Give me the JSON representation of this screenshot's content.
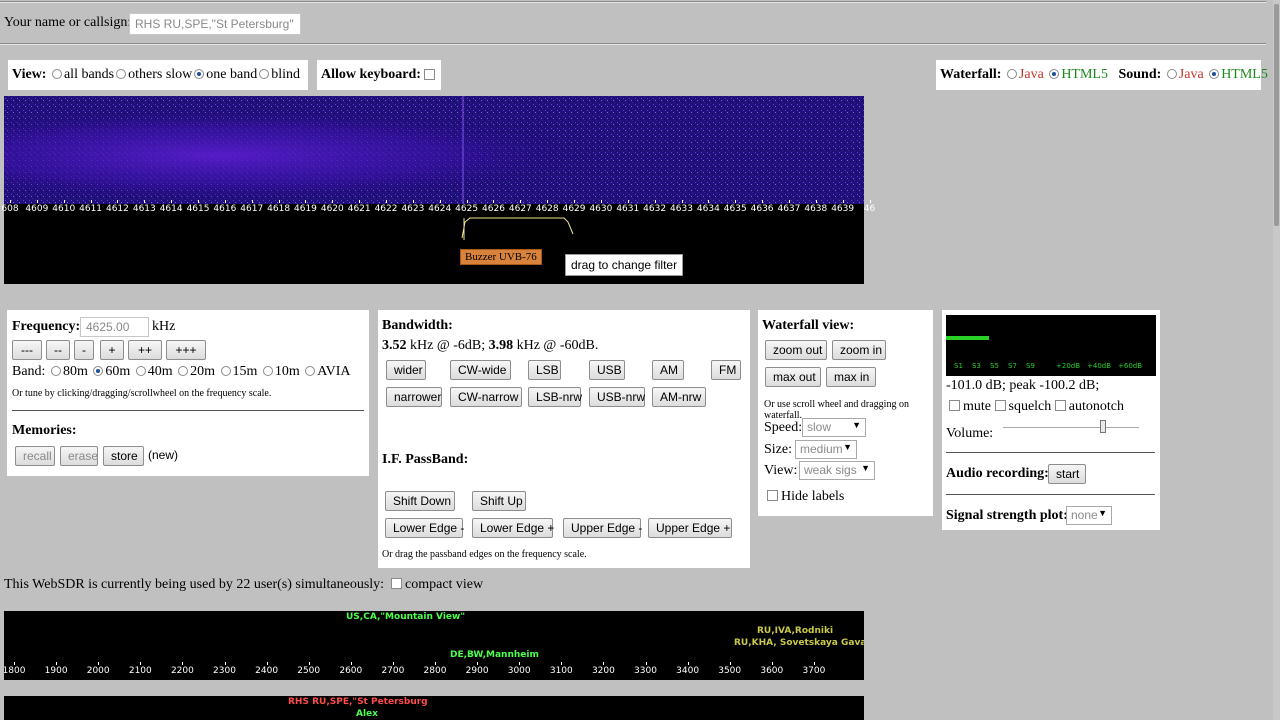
{
  "callsign": {
    "label": "Your name or callsign:",
    "value": "RHS RU,SPE,\"St Petersburg\""
  },
  "view": {
    "label": "View:",
    "options": [
      "all bands",
      "others slow",
      "one band",
      "blind"
    ],
    "selected": "one band",
    "keyboard_label": "Allow keyboard:"
  },
  "waterfall_sel": {
    "label": "Waterfall:",
    "java": "Java",
    "html5": "HTML5",
    "selected": "HTML5"
  },
  "sound_sel": {
    "label": "Sound:",
    "java": "Java",
    "html5": "HTML5",
    "selected": "HTML5"
  },
  "scale": {
    "ticks": [
      "608",
      "4609",
      "4610",
      "4611",
      "4612",
      "4613",
      "4614",
      "4615",
      "4616",
      "4617",
      "4618",
      "4619",
      "4620",
      "4621",
      "4622",
      "4623",
      "4624",
      "4625",
      "4626",
      "4627",
      "4628",
      "4629",
      "4630",
      "4631",
      "4632",
      "4633",
      "4634",
      "4635",
      "4636",
      "4637",
      "4638",
      "4639",
      "46"
    ],
    "station_label": "Buzzer UVB-76",
    "tooltip": "drag to change filter"
  },
  "frequency": {
    "label": "Frequency:",
    "value": "4625.00",
    "unit": "kHz",
    "step_buttons": [
      "---",
      "--",
      "-",
      "+",
      "++",
      "+++"
    ],
    "band_label": "Band:",
    "bands": [
      "80m",
      "60m",
      "40m",
      "20m",
      "15m",
      "10m",
      "AVIA"
    ],
    "band_selected": "60m",
    "hint": "Or tune by clicking/dragging/scrollwheel on the frequency scale."
  },
  "memories": {
    "label": "Memories:",
    "recall": "recall",
    "erase": "erase",
    "store": "store",
    "status": "(new)"
  },
  "bandwidth": {
    "label": "Bandwidth:",
    "bw6": "3.52",
    "bw6_text": "kHz @ -6dB;",
    "bw60": "3.98",
    "bw60_text": "kHz @ -60dB.",
    "row1": [
      "wider",
      "CW-wide",
      "LSB",
      "USB",
      "AM",
      "FM"
    ],
    "row2": [
      "narrower",
      "CW-narrow",
      "LSB-nrw",
      "USB-nrw",
      "AM-nrw"
    ],
    "passband_label": "I.F. PassBand:",
    "shift_down": "Shift Down",
    "shift_up": "Shift Up",
    "edges": [
      "Lower Edge -",
      "Lower Edge +",
      "Upper Edge -",
      "Upper Edge +"
    ],
    "hint": "Or drag the passband edges on the frequency scale."
  },
  "waterfall_view": {
    "label": "Waterfall view:",
    "zoom_out": "zoom out",
    "zoom_in": "zoom in",
    "max_out": "max out",
    "max_in": "max in",
    "hint": "Or use scroll wheel and dragging on waterfall.",
    "speed_label": "Speed:",
    "speed": "slow",
    "size_label": "Size:",
    "size": "medium",
    "view_label": "View:",
    "view": "weak sigs",
    "hide_labels": "Hide labels"
  },
  "smeter": {
    "scale": [
      "S1",
      "S3",
      "S5",
      "S7",
      "S9",
      "+20dB",
      "+40dB",
      "+60dB"
    ],
    "reading": "-101.0 dB; peak -100.2 dB;",
    "mute": "mute",
    "squelch": "squelch",
    "autonotch": "autonotch",
    "volume_label": "Volume:",
    "recording_label": "Audio recording:",
    "start": "start",
    "plot_label": "Signal strength plot:",
    "plot": "none"
  },
  "users": {
    "text": "This WebSDR is currently being used by 22 user(s) simultaneously:",
    "compact": "compact view"
  },
  "overview": {
    "labels": [
      "US,CA,\"Mountain View\"",
      "DE,BW,Mannheim",
      "RU,IVA,Rodniki",
      "RU,KHA, Sovetskaya Gavan'"
    ],
    "ticks": [
      "1800",
      "1900",
      "2000",
      "2100",
      "2200",
      "2300",
      "2400",
      "2500",
      "2600",
      "2700",
      "2800",
      "2900",
      "3000",
      "3100",
      "3200",
      "3300",
      "3400",
      "3500",
      "3600",
      "3700"
    ]
  },
  "bottom_strip": {
    "labels": [
      "RHS RU,SPE,\"St Petersburg",
      "Alex"
    ]
  },
  "colors": {
    "green": "#1a8a1a",
    "red": "#c0392b",
    "orange": "#d9823b",
    "yellow_label": "#c8c84a",
    "lime_label": "#4cff4c"
  }
}
